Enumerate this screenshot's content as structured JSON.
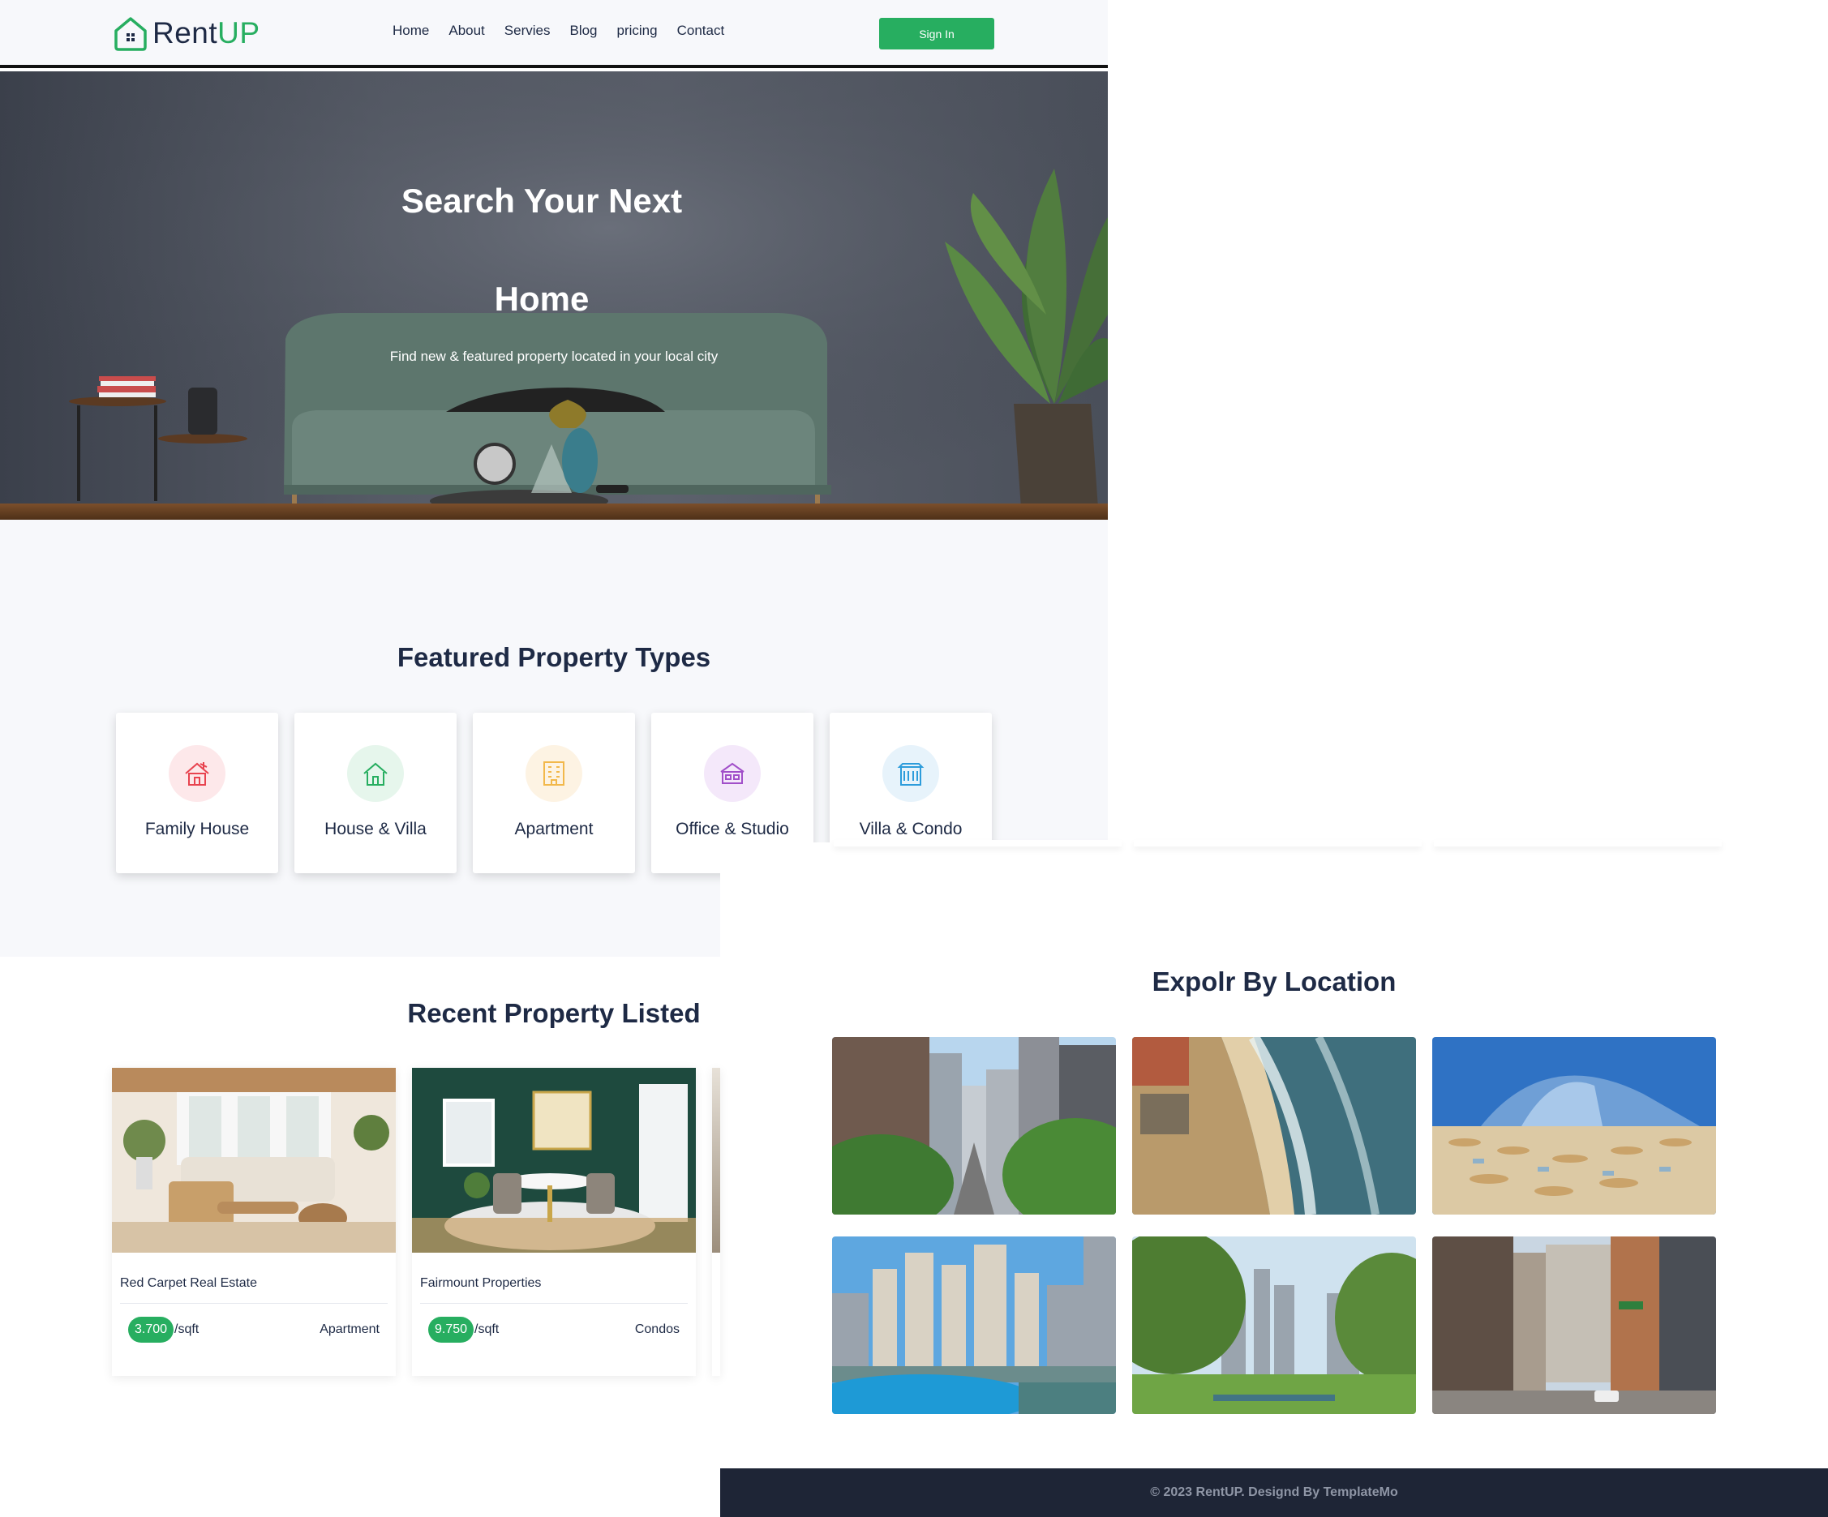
{
  "header": {
    "logo_main": "Rent",
    "logo_accent": "UP",
    "nav": [
      "Home",
      "About",
      "Servies",
      "Blog",
      "pricing",
      "Contact"
    ],
    "signin_label": "Sign In"
  },
  "hero": {
    "title_line1": "Search Your Next",
    "title_line2": "Home",
    "subtitle": "Find new & featured property located in your local city"
  },
  "featured": {
    "title": "Featured Property Types",
    "types": [
      {
        "label": "Family House",
        "icon": "family-house-icon",
        "color": "#e8434f",
        "bg": "#fde8ea"
      },
      {
        "label": "House & Villa",
        "icon": "house-villa-icon",
        "color": "#27ae60",
        "bg": "#e6f6ec"
      },
      {
        "label": "Apartment",
        "icon": "apartment-icon",
        "color": "#f2b84b",
        "bg": "#fdf3e3"
      },
      {
        "label": "Office & Studio",
        "icon": "office-studio-icon",
        "color": "#a14fc9",
        "bg": "#f4e8fa"
      },
      {
        "label": "Villa & Condo",
        "icon": "villa-condo-icon",
        "color": "#2d9cdb",
        "bg": "#e7f3fb"
      }
    ]
  },
  "recent": {
    "title": "Recent Property Listed",
    "listings": [
      {
        "name": "Red Carpet Real Estate",
        "price": "3.700",
        "unit": "/sqft",
        "type": "Apartment"
      },
      {
        "name": "Fairmount Properties",
        "price": "9.750",
        "unit": "/sqft",
        "type": "Condos"
      }
    ]
  },
  "locations": {
    "title": "Expolr By Location",
    "images": [
      "city-street",
      "beach-coast",
      "beach-hotel",
      "marina-skyline",
      "park-skyline",
      "avenue-buildings"
    ]
  },
  "footer": {
    "text": "© 2023 RentUP. Designd By TemplateMo"
  },
  "colors": {
    "accent": "#27ae60",
    "heading": "#1e2a45",
    "footer_bg": "#1e2536"
  }
}
